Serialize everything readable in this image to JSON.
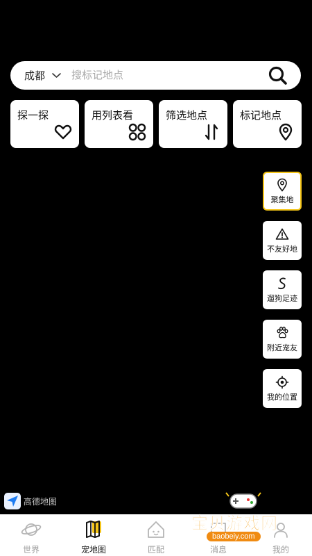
{
  "search": {
    "city": "成都",
    "placeholder": "搜标记地点"
  },
  "cards": [
    {
      "label": "探一探",
      "icon": "heart-icon"
    },
    {
      "label": "用列表看",
      "icon": "grid-icon"
    },
    {
      "label": "筛选地点",
      "icon": "sort-arrows-icon"
    },
    {
      "label": "标记地点",
      "icon": "location-pin-icon"
    }
  ],
  "tools": [
    {
      "label": "聚集地",
      "icon": "location-pin-icon"
    },
    {
      "label": "不友好地",
      "icon": "warning-icon"
    },
    {
      "label": "遛狗足迹",
      "icon": "path-icon"
    },
    {
      "label": "附近宠友",
      "icon": "paw-icon"
    },
    {
      "label": "我的位置",
      "icon": "crosshair-icon"
    }
  ],
  "map": {
    "attribution": "高德地图"
  },
  "nav": [
    {
      "label": "世界",
      "icon": "planet-icon"
    },
    {
      "label": "宠地图",
      "icon": "map-book-icon"
    },
    {
      "label": "匹配",
      "icon": "match-house-icon"
    },
    {
      "label": "消息",
      "icon": "message-icon"
    },
    {
      "label": "我的",
      "icon": "profile-icon"
    }
  ],
  "watermark": {
    "title": "宝贝游戏网",
    "url": "baobeiy.com"
  },
  "colors": {
    "accent": "#f5c518",
    "background": "#000000"
  }
}
